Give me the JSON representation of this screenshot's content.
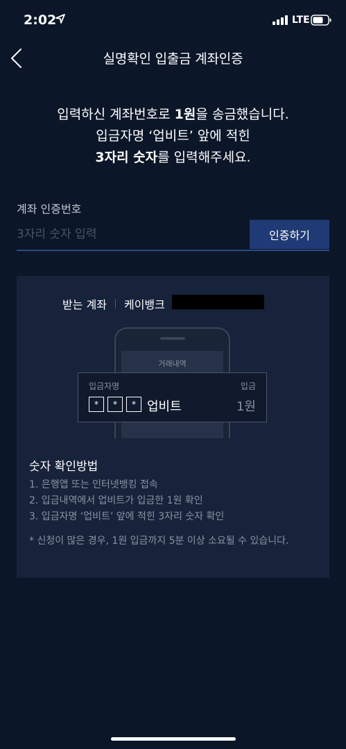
{
  "status_bar": {
    "time": "2:02",
    "network": "LTE",
    "icons": [
      "location-arrow-icon",
      "signal-bars-icon",
      "battery-icon"
    ]
  },
  "nav": {
    "back_icon": "chevron-left-icon",
    "title": "실명확인 입출금 계좌인증"
  },
  "instructions": {
    "line1_pre": "입력하신 계좌번호로 ",
    "line1_bold": "1원",
    "line1_post": "을 송금했습니다.",
    "line2": "입금자명 ‘업비트’ 앞에 적힌",
    "line3_bold": "3자리 숫자",
    "line3_post": "를 입력해주세요."
  },
  "auth_field": {
    "label": "계좌 인증번호",
    "placeholder": "3자리 숫자 입력",
    "value": "",
    "button": "인증하기"
  },
  "info_card": {
    "receiving_label": "받는 계좌",
    "bank_name": "케이뱅크",
    "phone_screen_title": "거래내역",
    "deposit": {
      "name_label": "입금자명",
      "type_label": "입금",
      "masked_digits": [
        "*",
        "*",
        "*"
      ],
      "sender": "업비트",
      "amount": "1원"
    },
    "method_title": "숫자 확인방법",
    "method_steps": [
      "1. 은행앱 또는 인터넷뱅킹 접속",
      "2. 입금내역에서 업비트가 입금한 1원 확인",
      "3. 입금자명 ‘업비트’ 앞에 적힌 3자리 숫자 확인"
    ],
    "note": "* 신청이 많은 경우, 1원 입금까지 5분 이상 소요될 수 있습니다."
  },
  "colors": {
    "background": "#0b1628",
    "card": "#17233a",
    "button": "#1f3a74",
    "underline": "#2a4a8c",
    "muted_text": "#8a93a3"
  }
}
